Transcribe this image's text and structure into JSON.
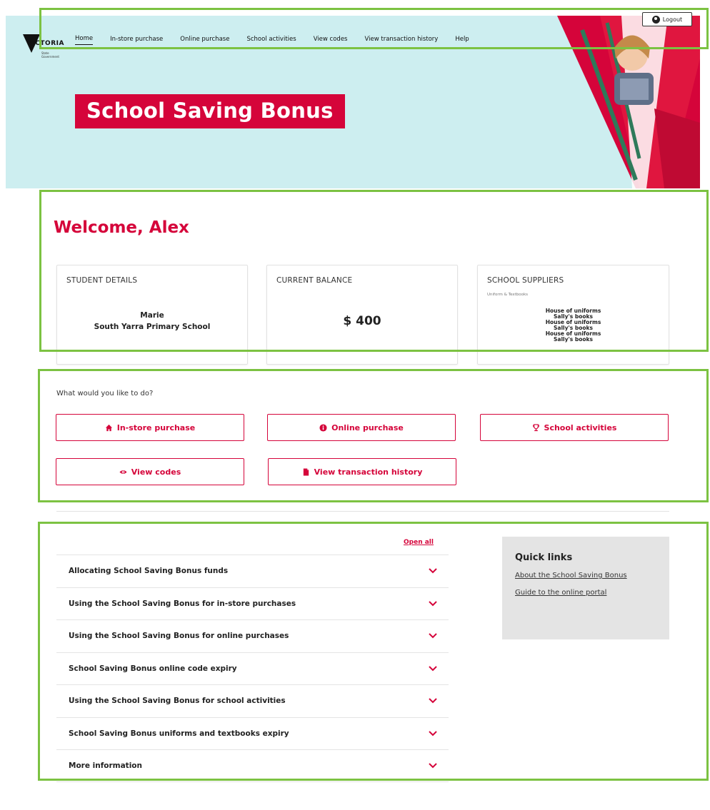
{
  "brand": {
    "logo_text": "VICTORIA",
    "logo_sub": "State Government",
    "accent": "#d5043a",
    "hero_bg": "#cdeef0"
  },
  "nav": {
    "items": [
      {
        "label": "Home",
        "active": true
      },
      {
        "label": "In-store purchase"
      },
      {
        "label": "Online purchase"
      },
      {
        "label": "School activities"
      },
      {
        "label": "View codes"
      },
      {
        "label": "View transaction history"
      },
      {
        "label": "Help"
      }
    ],
    "logout_label": "Logout",
    "logout_icon": "user-icon"
  },
  "hero": {
    "title": "School Saving Bonus"
  },
  "welcome": {
    "heading": "Welcome, Alex"
  },
  "cards": {
    "student": {
      "label": "STUDENT DETAILS",
      "name": "Marie",
      "school": "South Yarra Primary School"
    },
    "balance": {
      "label": "CURRENT BALANCE",
      "value": "$ 400"
    },
    "suppliers": {
      "label": "SCHOOL SUPPLIERS",
      "subtitle": "Uniform & Textbooks",
      "items": [
        "House of uniforms",
        "Sally's books",
        "House of uniforms",
        "Sally's books",
        "House of uniforms",
        "Sally's books"
      ]
    }
  },
  "actions": {
    "question": "What would you like to do?",
    "buttons": [
      {
        "label": "In-store purchase",
        "icon": "home-icon"
      },
      {
        "label": "Online purchase",
        "icon": "info-icon"
      },
      {
        "label": "School activities",
        "icon": "trophy-icon"
      },
      {
        "label": "View codes",
        "icon": "eye-icon"
      },
      {
        "label": "View transaction history",
        "icon": "document-icon"
      }
    ]
  },
  "accordion": {
    "open_all_label": "Open all",
    "items": [
      "Allocating School Saving Bonus funds",
      "Using the School Saving Bonus for in-store purchases",
      "Using the School Saving Bonus for online purchases",
      "School Saving Bonus online code expiry",
      "Using the School Saving Bonus for school activities",
      "School Saving Bonus uniforms and textbooks expiry",
      "More information"
    ]
  },
  "quick_links": {
    "title": "Quick links",
    "links": [
      "About the School Saving Bonus",
      "Guide to the online portal"
    ]
  }
}
